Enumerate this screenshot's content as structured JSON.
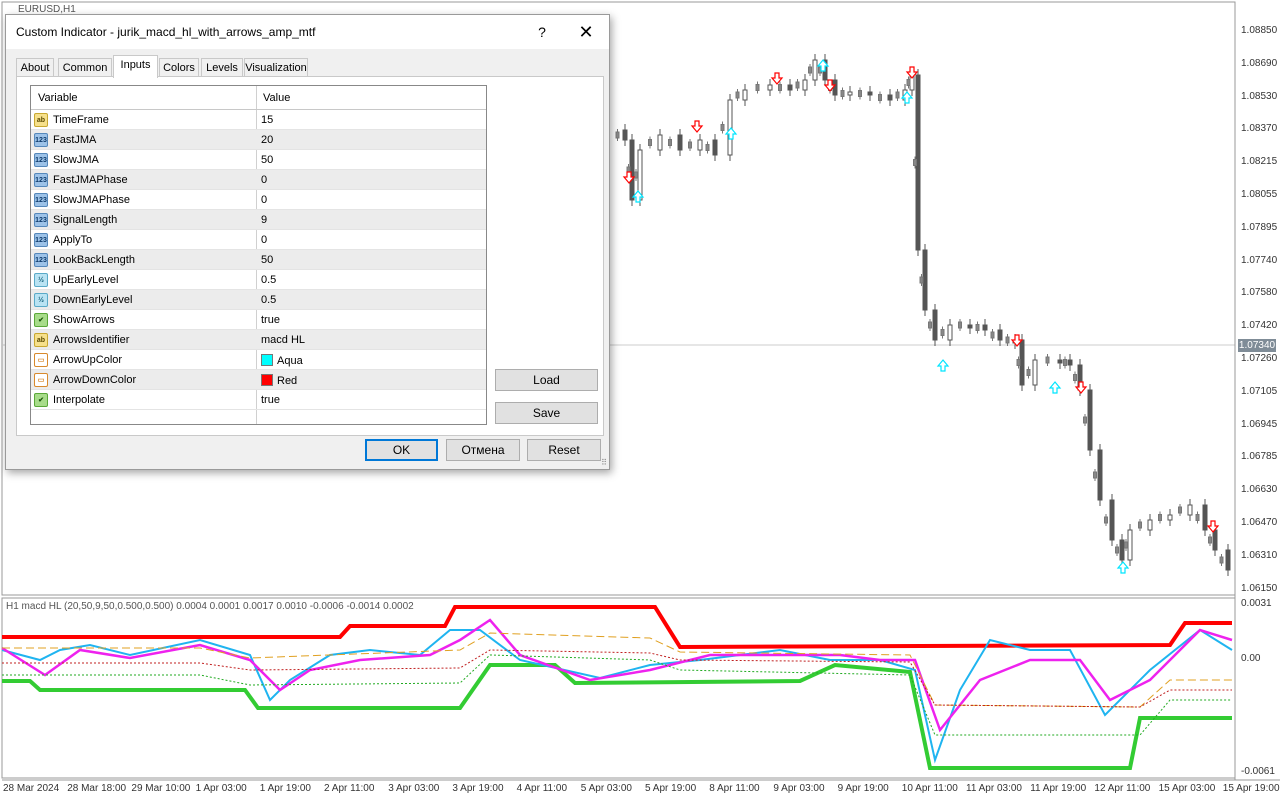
{
  "chart": {
    "symbol_title": "EURUSD,H1",
    "indicator_title": "H1 macd HL (20,50,9,50,0.500,0.500) 0.0004 0.0001 0.0017 0.0010 -0.0006 -0.0014 0.0002",
    "current_price": "1.07340",
    "price_axis": [
      "1.08850",
      "1.08690",
      "1.08530",
      "1.08370",
      "1.08215",
      "1.08055",
      "1.07895",
      "1.07740",
      "1.07580",
      "1.07420",
      "1.07260",
      "1.07105",
      "1.06945",
      "1.06785",
      "1.06630",
      "1.06470",
      "1.06310",
      "1.06150"
    ],
    "indicator_axis": [
      "0.0031",
      "0.00",
      "-0.0061"
    ],
    "time_axis": [
      "28 Mar 2024",
      "28 Mar 18:00",
      "29 Mar 10:00",
      "1 Apr 03:00",
      "1 Apr 19:00",
      "2 Apr 11:00",
      "3 Apr 03:00",
      "3 Apr 19:00",
      "4 Apr 11:00",
      "5 Apr 03:00",
      "5 Apr 19:00",
      "8 Apr 11:00",
      "9 Apr 03:00",
      "9 Apr 19:00",
      "10 Apr 11:00",
      "11 Apr 03:00",
      "11 Apr 19:00",
      "12 Apr 11:00",
      "15 Apr 03:00",
      "15 Apr 19:00"
    ],
    "colors": {
      "up_arrow": "#00e5ff",
      "down_arrow": "#ff0000",
      "upper_band": "#ff0000",
      "lower_band": "#33cc33",
      "macd": "#1fb4f0",
      "signal": "#ee22ee",
      "level": "#e0a020"
    }
  },
  "dialog": {
    "title": "Custom Indicator - jurik_macd_hl_with_arrows_amp_mtf",
    "help": "?",
    "close": "✕",
    "tabs": [
      "About",
      "Common",
      "Inputs",
      "Colors",
      "Levels",
      "Visualization"
    ],
    "active_tab": "Inputs",
    "grid_headers": {
      "variable": "Variable",
      "value": "Value"
    },
    "rows": [
      {
        "icon": "ab",
        "name": "TimeFrame",
        "value": "15"
      },
      {
        "icon": "123",
        "name": "FastJMA",
        "value": "20"
      },
      {
        "icon": "123",
        "name": "SlowJMA",
        "value": "50"
      },
      {
        "icon": "123",
        "name": "FastJMAPhase",
        "value": "0"
      },
      {
        "icon": "123",
        "name": "SlowJMAPhase",
        "value": "0"
      },
      {
        "icon": "123",
        "name": "SignalLength",
        "value": "9"
      },
      {
        "icon": "123",
        "name": "ApplyTo",
        "value": "0"
      },
      {
        "icon": "123",
        "name": "LookBackLength",
        "value": "50"
      },
      {
        "icon": "½",
        "name": "UpEarlyLevel",
        "value": "0.5"
      },
      {
        "icon": "½",
        "name": "DownEarlyLevel",
        "value": "0.5"
      },
      {
        "icon": "bool",
        "name": "ShowArrows",
        "value": "true"
      },
      {
        "icon": "ab",
        "name": "ArrowsIdentifier",
        "value": "macd HL"
      },
      {
        "icon": "color",
        "name": "ArrowUpColor",
        "value": "Aqua",
        "swatch": "#00ffff"
      },
      {
        "icon": "color",
        "name": "ArrowDownColor",
        "value": "Red",
        "swatch": "#ff0000"
      },
      {
        "icon": "bool",
        "name": "Interpolate",
        "value": "true"
      }
    ],
    "load_button": "Load",
    "save_button": "Save",
    "ok_button": "OK",
    "cancel_button": "Отмена",
    "reset_button": "Reset"
  }
}
